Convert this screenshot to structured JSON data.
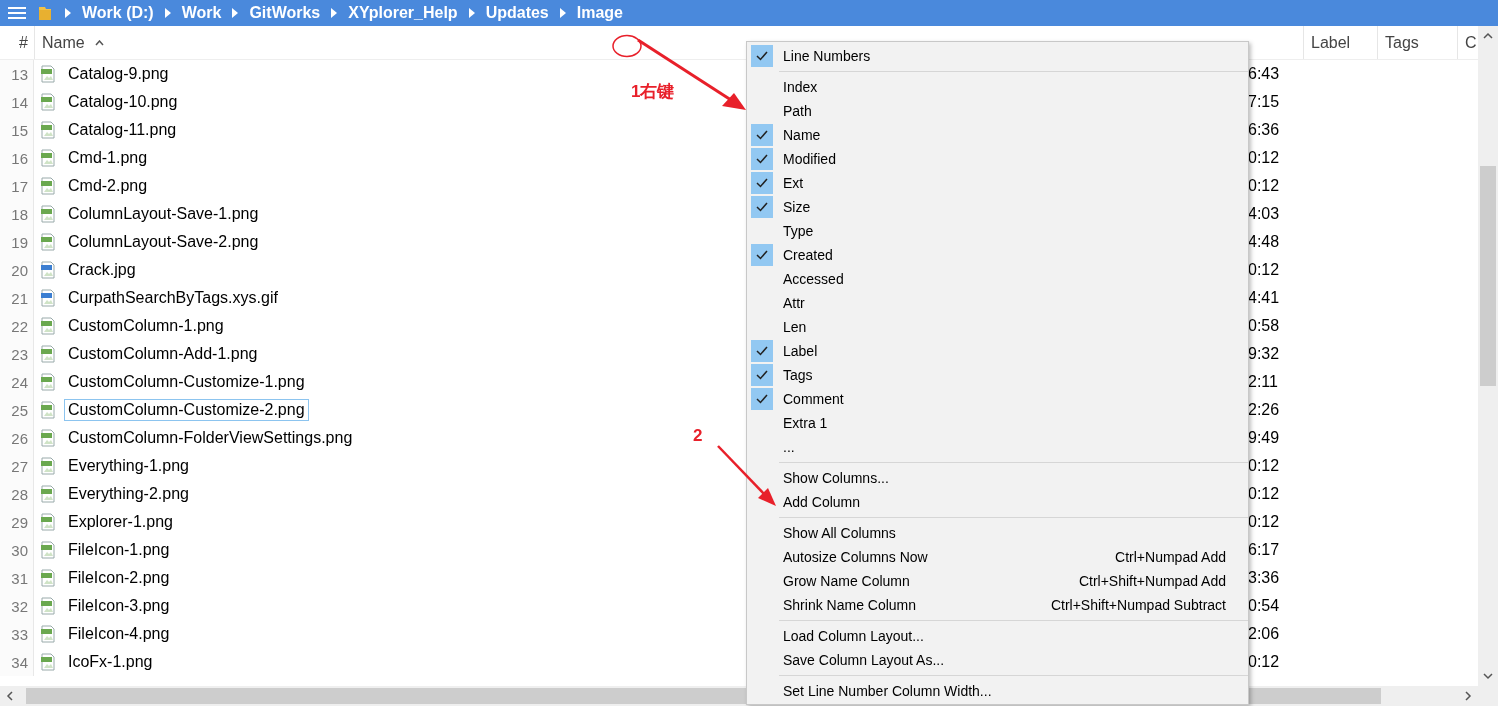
{
  "breadcrumb": [
    "Work (D:)",
    "Work",
    "GitWorks",
    "XYplorer_Help",
    "Updates",
    "Image"
  ],
  "columns": [
    {
      "label": "#"
    },
    {
      "label": "Name",
      "sorted": true
    },
    {
      "label": "Label"
    },
    {
      "label": "Tags"
    },
    {
      "label": "C"
    }
  ],
  "rows": [
    {
      "number": "13",
      "name": "Catalog-9.png",
      "kind": "png",
      "created": "6:43",
      "selected": false
    },
    {
      "number": "14",
      "name": "Catalog-10.png",
      "kind": "png",
      "created": "7:15",
      "selected": false
    },
    {
      "number": "15",
      "name": "Catalog-11.png",
      "kind": "png",
      "created": "6:36",
      "selected": false
    },
    {
      "number": "16",
      "name": "Cmd-1.png",
      "kind": "png",
      "created": "0:12",
      "selected": false
    },
    {
      "number": "17",
      "name": "Cmd-2.png",
      "kind": "png",
      "created": "0:12",
      "selected": false
    },
    {
      "number": "18",
      "name": "ColumnLayout-Save-1.png",
      "kind": "png",
      "created": "4:03",
      "selected": false
    },
    {
      "number": "19",
      "name": "ColumnLayout-Save-2.png",
      "kind": "png",
      "created": "4:48",
      "selected": false
    },
    {
      "number": "20",
      "name": "Crack.jpg",
      "kind": "other",
      "created": "0:12",
      "selected": false
    },
    {
      "number": "21",
      "name": "CurpathSearchByTags.xys.gif",
      "kind": "other",
      "created": "4:41",
      "selected": false
    },
    {
      "number": "22",
      "name": "CustomColumn-1.png",
      "kind": "png",
      "created": "0:58",
      "selected": false
    },
    {
      "number": "23",
      "name": "CustomColumn-Add-1.png",
      "kind": "png",
      "created": "9:32",
      "selected": false
    },
    {
      "number": "24",
      "name": "CustomColumn-Customize-1.png",
      "kind": "png",
      "created": "2:11",
      "selected": false
    },
    {
      "number": "25",
      "name": "CustomColumn-Customize-2.png",
      "kind": "png",
      "created": "2:26",
      "selected": true
    },
    {
      "number": "26",
      "name": "CustomColumn-FolderViewSettings.png",
      "kind": "png",
      "created": "9:49",
      "selected": false
    },
    {
      "number": "27",
      "name": "Everything-1.png",
      "kind": "png",
      "created": "0:12",
      "selected": false
    },
    {
      "number": "28",
      "name": "Everything-2.png",
      "kind": "png",
      "created": "0:12",
      "selected": false
    },
    {
      "number": "29",
      "name": "Explorer-1.png",
      "kind": "png",
      "created": "0:12",
      "selected": false
    },
    {
      "number": "30",
      "name": "FileIcon-1.png",
      "kind": "png",
      "created": "6:17",
      "selected": false
    },
    {
      "number": "31",
      "name": "FileIcon-2.png",
      "kind": "png",
      "created": "3:36",
      "selected": false
    },
    {
      "number": "32",
      "name": "FileIcon-3.png",
      "kind": "png",
      "created": "0:54",
      "selected": false
    },
    {
      "number": "33",
      "name": "FileIcon-4.png",
      "kind": "png",
      "created": "2:06",
      "selected": false
    },
    {
      "number": "34",
      "name": "IcoFx-1.png",
      "kind": "png",
      "created": "0:12",
      "selected": false
    }
  ],
  "context_menu": [
    [
      {
        "label": "Line Numbers",
        "checked": true
      }
    ],
    [
      {
        "label": "Index",
        "checked": false
      },
      {
        "label": "Path",
        "checked": false
      },
      {
        "label": "Name",
        "checked": true
      },
      {
        "label": "Modified",
        "checked": true
      },
      {
        "label": "Ext",
        "checked": true
      },
      {
        "label": "Size",
        "checked": true
      },
      {
        "label": "Type",
        "checked": false
      },
      {
        "label": "Created",
        "checked": true
      },
      {
        "label": "Accessed",
        "checked": false
      },
      {
        "label": "Attr",
        "checked": false
      },
      {
        "label": "Len",
        "checked": false
      },
      {
        "label": "Label",
        "checked": true
      },
      {
        "label": "Tags",
        "checked": true
      },
      {
        "label": "Comment",
        "checked": true
      },
      {
        "label": "Extra 1",
        "checked": false
      },
      {
        "label": "...",
        "checked": false
      }
    ],
    [
      {
        "label": "Show Columns...",
        "checked": false
      },
      {
        "label": "Add Column",
        "checked": false
      }
    ],
    [
      {
        "label": "Show All Columns",
        "checked": false
      },
      {
        "label": "Autosize Columns Now",
        "checked": false,
        "shortcut": "Ctrl+Numpad Add"
      },
      {
        "label": "Grow Name Column",
        "checked": false,
        "shortcut": "Ctrl+Shift+Numpad Add"
      },
      {
        "label": "Shrink Name Column",
        "checked": false,
        "shortcut": "Ctrl+Shift+Numpad Subtract"
      }
    ],
    [
      {
        "label": "Load Column Layout...",
        "checked": false
      },
      {
        "label": "Save Column Layout As...",
        "checked": false
      }
    ],
    [
      {
        "label": "Set Line Number Column Width...",
        "checked": false
      }
    ]
  ],
  "annotations": [
    {
      "label": "1右键"
    },
    {
      "label": "2"
    }
  ]
}
